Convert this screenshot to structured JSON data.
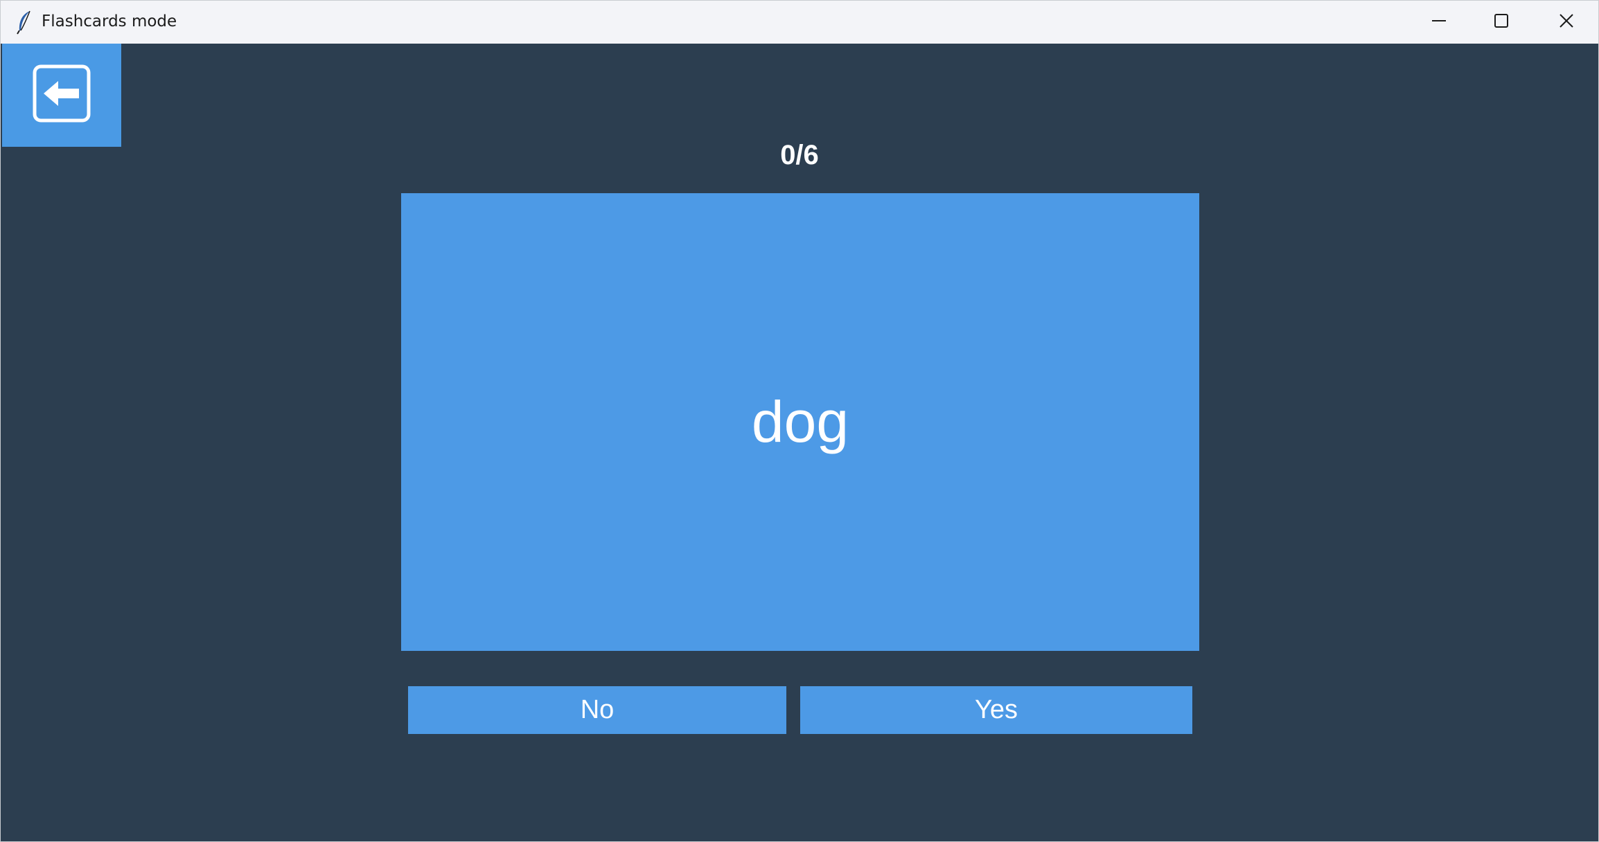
{
  "window": {
    "title": "Flashcards mode",
    "icons": {
      "app": "feather-icon",
      "minimize": "minimize-icon",
      "maximize": "maximize-icon",
      "close": "close-icon"
    }
  },
  "toolbar": {
    "back_icon": "back-arrow-icon"
  },
  "session": {
    "progress": "0/6",
    "completed": 0,
    "total": 6
  },
  "card": {
    "word": "dog"
  },
  "answers": {
    "no_label": "No",
    "yes_label": "Yes"
  },
  "colors": {
    "background": "#2c3e50",
    "accent": "#4d9ae6",
    "text": "#ffffff"
  }
}
